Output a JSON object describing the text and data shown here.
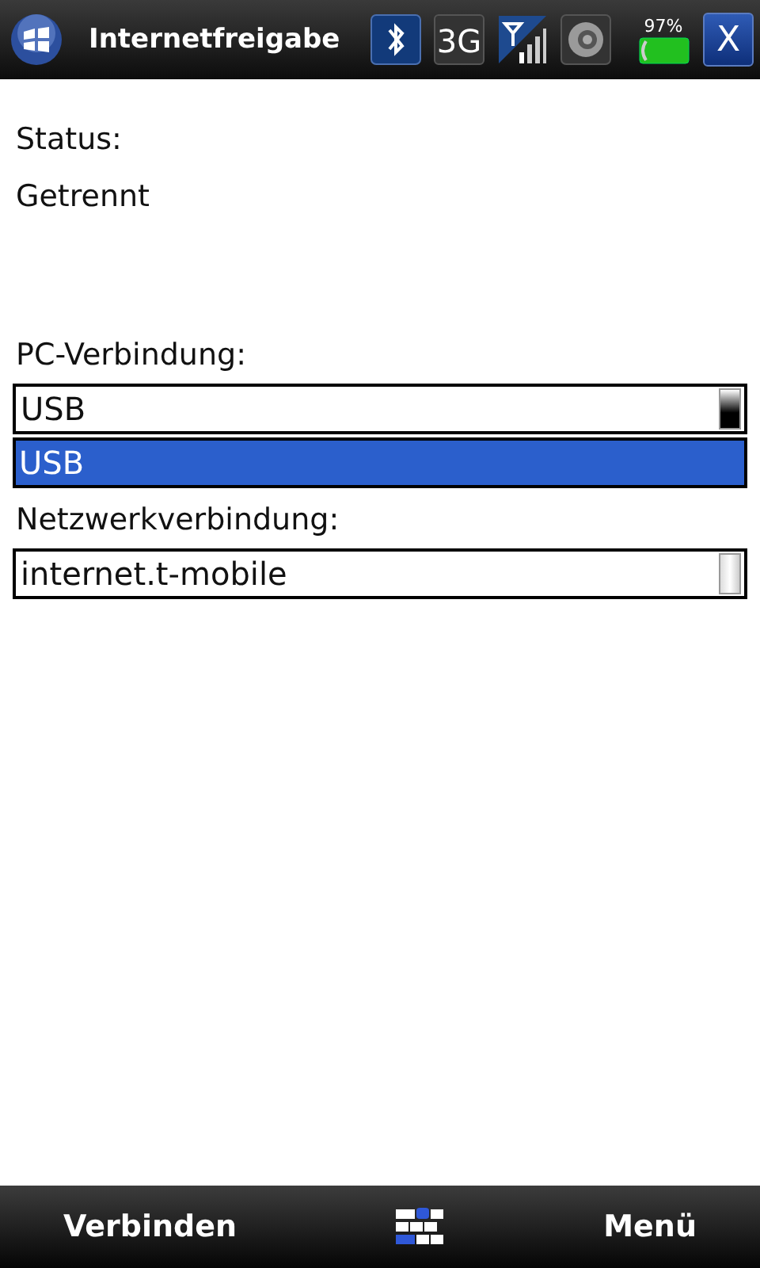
{
  "title_bar": {
    "title": "Internetfreigabe",
    "battery_text": "97%",
    "close_label": "X",
    "network_label": "3G"
  },
  "status": {
    "label": "Status:",
    "value": "Getrennt"
  },
  "pc_connection": {
    "label": "PC-Verbindung:",
    "value": "USB",
    "expanded": true,
    "options": [
      {
        "label": "USB",
        "selected": true
      }
    ]
  },
  "network_connection": {
    "label": "Netzwerkverbindung:",
    "value": "internet.t-mobile",
    "expanded": false
  },
  "soft_keys": {
    "left": "Verbinden",
    "right": "Menü"
  }
}
